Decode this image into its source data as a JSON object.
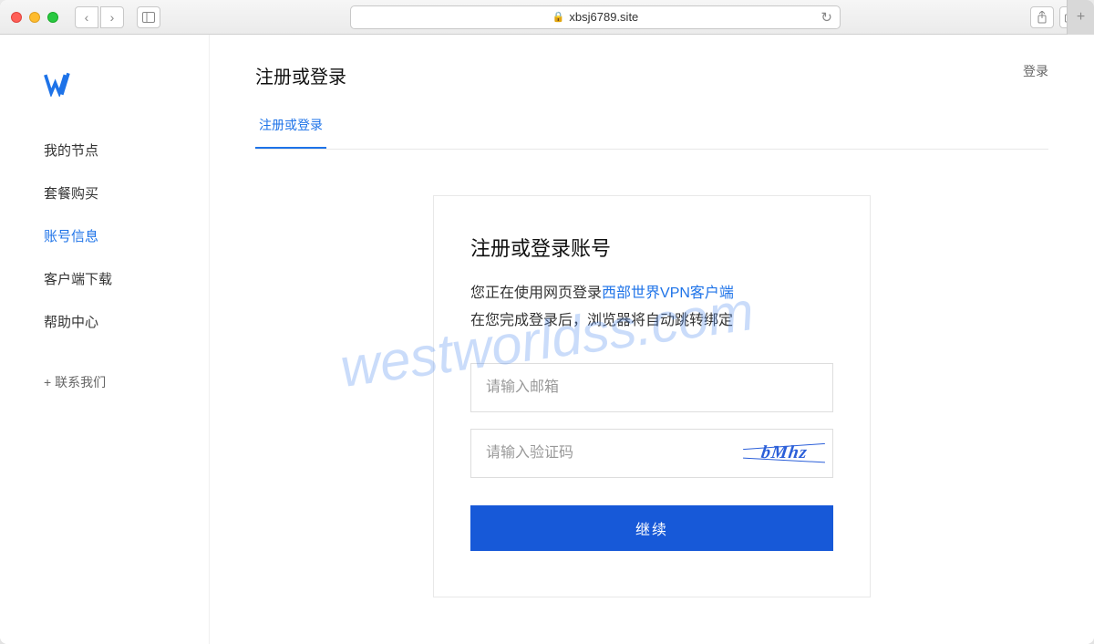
{
  "browser": {
    "url_host": "xbsj6789.site"
  },
  "sidebar": {
    "items": [
      {
        "label": "我的节点"
      },
      {
        "label": "套餐购买"
      },
      {
        "label": "账号信息"
      },
      {
        "label": "客户端下载"
      },
      {
        "label": "帮助中心"
      }
    ],
    "contact_label": "+  联系我们"
  },
  "header": {
    "page_title": "注册或登录",
    "login_link": "登录"
  },
  "tabs": {
    "active_label": "注册或登录"
  },
  "card": {
    "title": "注册或登录账号",
    "desc_prefix": "您正在使用网页登录",
    "desc_link": "西部世界VPN客户端",
    "desc_line2": "在您完成登录后，浏览器将自动跳转绑定",
    "email_placeholder": "请输入邮箱",
    "captcha_placeholder": "请输入验证码",
    "captcha_value": "bMhz",
    "continue_label": "继续"
  },
  "watermark": "westworldss.com"
}
